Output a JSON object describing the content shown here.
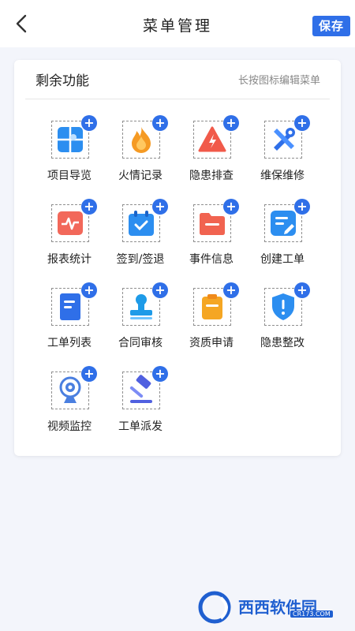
{
  "header": {
    "title": "菜单管理",
    "save_label": "保存",
    "back_icon": "chevron-left-icon"
  },
  "section": {
    "title": "剩余功能",
    "hint": "长按图标编辑菜单"
  },
  "menu_items": [
    {
      "label": "项目导览",
      "icon": "map-grid-icon",
      "color": "#2c8ef0"
    },
    {
      "label": "火情记录",
      "icon": "flame-icon",
      "color": "#f59a23"
    },
    {
      "label": "隐患排查",
      "icon": "warning-triangle-icon",
      "color": "#f15a4a"
    },
    {
      "label": "维保维修",
      "icon": "tools-icon",
      "color": "#2f6fe8"
    },
    {
      "label": "报表统计",
      "icon": "chart-pulse-icon",
      "color": "#f2685a"
    },
    {
      "label": "签到/签退",
      "icon": "calendar-check-icon",
      "color": "#2c8ef0"
    },
    {
      "label": "事件信息",
      "icon": "folder-icon",
      "color": "#f16350"
    },
    {
      "label": "创建工单",
      "icon": "edit-note-icon",
      "color": "#2c8ef0"
    },
    {
      "label": "工单列表",
      "icon": "document-list-icon",
      "color": "#2f6fe8"
    },
    {
      "label": "合同审核",
      "icon": "stamp-icon",
      "color": "#1e9be8"
    },
    {
      "label": "资质申请",
      "icon": "clipboard-icon",
      "color": "#f5a623"
    },
    {
      "label": "隐患整改",
      "icon": "shield-alert-icon",
      "color": "#2c8ef0"
    },
    {
      "label": "视频监控",
      "icon": "webcam-icon",
      "color": "#4a7fe0"
    },
    {
      "label": "工单派发",
      "icon": "gavel-icon",
      "color": "#5060e0"
    }
  ],
  "add_badge": "+",
  "watermark": {
    "text": "西西软件园",
    "sub": "CR173.COM"
  }
}
